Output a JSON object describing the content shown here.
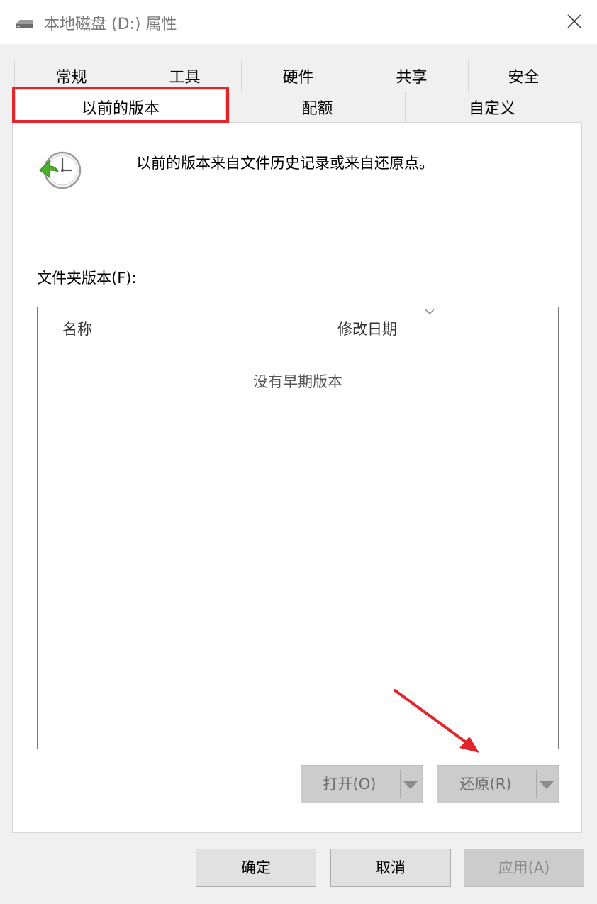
{
  "window": {
    "title": "本地磁盘 (D:) 属性",
    "close_icon": "close-icon",
    "drive_icon": "drive-icon"
  },
  "tabs": {
    "row1": [
      "常规",
      "工具",
      "硬件",
      "共享",
      "安全"
    ],
    "row2": [
      "以前的版本",
      "配额",
      "自定义"
    ],
    "active": "以前的版本"
  },
  "panel": {
    "description": "以前的版本来自文件历史记录或来自还原点。",
    "folder_versions_label": "文件夹版本(F):",
    "list": {
      "columns": [
        "名称",
        "修改日期"
      ],
      "empty_message": "没有早期版本"
    },
    "open_button": "打开(O)",
    "restore_button": "还原(R)"
  },
  "footer": {
    "ok": "确定",
    "cancel": "取消",
    "apply": "应用(A)"
  },
  "colors": {
    "highlight": "#e0262a",
    "arrow": "#e0262a"
  }
}
